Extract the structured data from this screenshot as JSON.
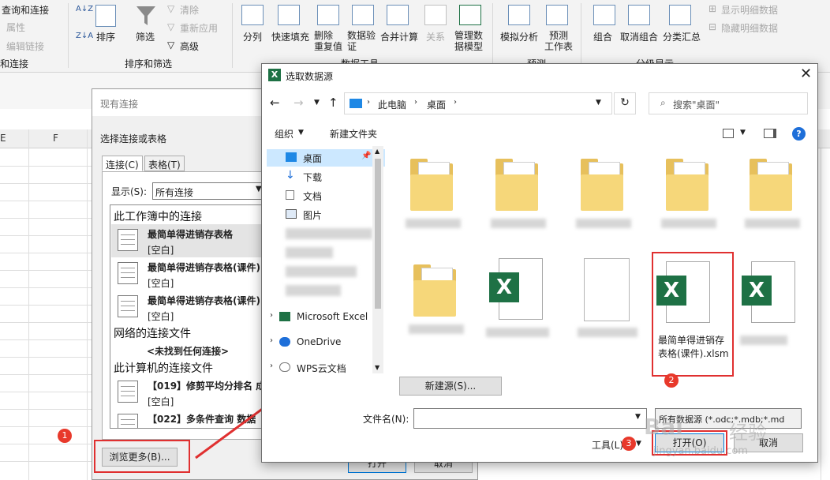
{
  "ribbon": {
    "query_connect": "查询和连接",
    "properties": "属性",
    "edit_links": "编辑链接",
    "group_connect": "和连接",
    "sort": "排序",
    "filter": "筛选",
    "clear": "清除",
    "reapply": "重新应用",
    "advanced": "高级",
    "group_sort_filter": "排序和筛选",
    "split": "分列",
    "flash_fill": "快速填充",
    "remove_dup": "删除\n重复值",
    "data_validation": "数据验\n证",
    "consolidate": "合并计算",
    "relations": "关系",
    "manage_model": "管理数\n据模型",
    "group_data_tools": "数据工具",
    "what_if": "模拟分析",
    "forecast_sheet": "预测\n工作表",
    "group_forecast": "预测",
    "group": "组合",
    "ungroup": "取消组合",
    "subtotal": "分类汇总",
    "show_detail": "显示明细数据",
    "hide_detail": "隐藏明细数据",
    "group_outline": "分级显示"
  },
  "sheet": {
    "col_e": "E",
    "col_f": "F"
  },
  "existing_connections": {
    "title": "现有连接",
    "choose_label": "选择连接或表格",
    "tab_connections": "连接(C)",
    "tab_tables": "表格(T)",
    "show_label": "显示(S):",
    "show_value": "所有连接",
    "section_workbook": "此工作簿中的连接",
    "items_workbook": [
      {
        "title": "最简单得进销存表格",
        "sub": "[空白]"
      },
      {
        "title": "最简单得进销存表格(课件)",
        "sub": "[空白]"
      },
      {
        "title": "最简单得进销存表格(课件)",
        "sub": "[空白]"
      }
    ],
    "section_network": "网络的连接文件",
    "network_none": "<未找到任何连接>",
    "section_computer": "此计算机的连接文件",
    "items_computer": [
      {
        "title": "【019】修剪平均分排名 成",
        "sub": "[空白]"
      },
      {
        "title": "【022】多条件查询 数据",
        "sub": ""
      }
    ],
    "browse_button": "浏览更多(B)...",
    "open_button": "打开",
    "cancel_button": "取消",
    "badge_1": "1"
  },
  "file_dialog": {
    "title": "选取数据源",
    "breadcrumb": [
      "此电脑",
      "桌面"
    ],
    "search_placeholder": "搜索\"桌面\"",
    "organize": "组织",
    "new_folder": "新建文件夹",
    "nav_items": [
      {
        "label": "桌面"
      },
      {
        "label": "下载"
      },
      {
        "label": "文档"
      },
      {
        "label": "图片"
      }
    ],
    "nav_apps": [
      {
        "label": "Microsoft Excel"
      },
      {
        "label": "OneDrive"
      },
      {
        "label": "WPS云文档"
      }
    ],
    "highlighted_file": "最简单得进销存\n表格(课件).xlsm",
    "new_source": "新建源(S)...",
    "filename_label": "文件名(N):",
    "filetype_value": "所有数据源 (*.odc;*.mdb;*.md",
    "tools": "工具(L)",
    "open": "打开(O)",
    "cancel": "取消",
    "badge_2": "2",
    "badge_3": "3"
  },
  "watermark": {
    "line1": "Bai",
    "line2": "经验",
    "line3": "jingyan.baidu.com"
  }
}
